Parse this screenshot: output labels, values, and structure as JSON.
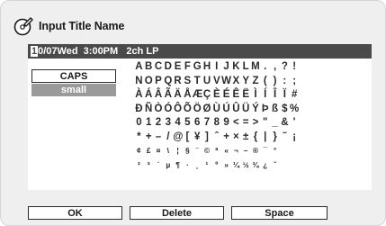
{
  "dialog": {
    "title": "Input Title Name",
    "icon": "disc-pencil-icon"
  },
  "title_field": {
    "cursor_char": "1",
    "rest": "0/07Wed  3:00PM   2ch LP"
  },
  "case_buttons": {
    "caps": "CAPS",
    "small": "small"
  },
  "character_rows": [
    [
      "A",
      "B",
      "C",
      "D",
      "E",
      "F",
      "G",
      "H",
      "I",
      "J",
      "K",
      "L",
      "M",
      ".",
      ",",
      "?",
      "!"
    ],
    [
      "N",
      "O",
      "P",
      "Q",
      "R",
      "S",
      "T",
      "U",
      "V",
      "W",
      "X",
      "Y",
      "Z",
      "(",
      ")",
      ":",
      ";"
    ],
    [
      "À",
      "Á",
      "Â",
      "Ã",
      "Ä",
      "Å",
      "Æ",
      "Ç",
      "È",
      "É",
      "Ê",
      "Ë",
      "Ì",
      "Í",
      "Î",
      "Ï",
      "#"
    ],
    [
      "Ð",
      "Ñ",
      "Ò",
      "Ó",
      "Ô",
      "Õ",
      "Ö",
      "Ø",
      "Ù",
      "Ú",
      "Û",
      "Ü",
      "Ý",
      "Þ",
      "ß",
      "$",
      "%"
    ],
    [
      "0",
      "1",
      "2",
      "3",
      "4",
      "5",
      "6",
      "7",
      "8",
      "9",
      "<",
      "=",
      ">",
      "\"",
      "_",
      "&",
      "'"
    ],
    [
      "*",
      "+",
      "–",
      "/",
      "@",
      "[",
      "¥",
      "]",
      "ˆ",
      "+",
      "×",
      "±",
      "{",
      "|",
      "}",
      "˜",
      "¡"
    ],
    [
      "¢",
      "£",
      "¤",
      "\\",
      "¦",
      "§",
      "¨",
      "©",
      "ª",
      "«",
      "¬",
      "–",
      "®",
      "¯",
      "°",
      "",
      ""
    ],
    [
      "²",
      "³",
      "´",
      "µ",
      "¶",
      "·",
      "¸",
      "¹",
      "º",
      "»",
      "¼",
      "½",
      "¾",
      "¿",
      "ˇ",
      "",
      ""
    ]
  ],
  "actions": {
    "ok": "OK",
    "delete": "Delete",
    "space": "Space"
  }
}
